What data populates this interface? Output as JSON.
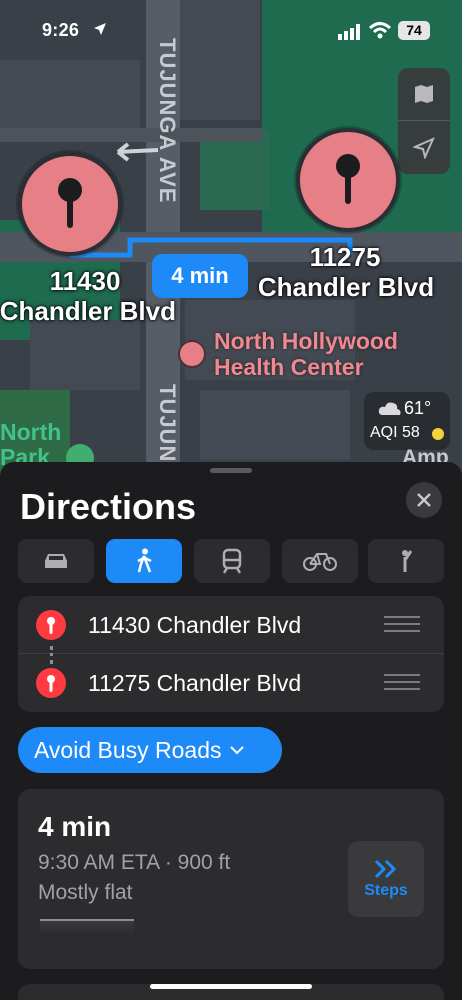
{
  "status_bar": {
    "time": "9:26",
    "battery": "74"
  },
  "map": {
    "pins": [
      {
        "label_line1": "11430",
        "label_line2": "Chandler Blvd"
      },
      {
        "label_line1": "11275",
        "label_line2": "Chandler Blvd"
      }
    ],
    "route_time": "4 min",
    "street_top": "TUJUNGA AVE",
    "street_bottom": "TUJUN",
    "poi": {
      "line1": "North Hollywood",
      "line2": "Health Center"
    },
    "park": {
      "line1": "North",
      "line2": "Park"
    },
    "weather": {
      "temp": "61°",
      "aqi": "AQI 58"
    },
    "amp_label": "Amp"
  },
  "sheet": {
    "title": "Directions",
    "modes": [
      "drive",
      "walk",
      "transit",
      "cycle",
      "rideshare"
    ],
    "active_mode": "walk",
    "origin": "11430 Chandler Blvd",
    "destination": "11275 Chandler Blvd",
    "avoid_label": "Avoid Busy Roads",
    "result": {
      "duration": "4 min",
      "eta_line": "9:30 AM ETA · 900 ft",
      "grade": "Mostly flat",
      "steps_label": "Steps"
    }
  },
  "colors": {
    "accent": "#1d8af8",
    "pin": "#e77f86",
    "route_pin": "#ff3b41",
    "park": "#42c28a"
  }
}
